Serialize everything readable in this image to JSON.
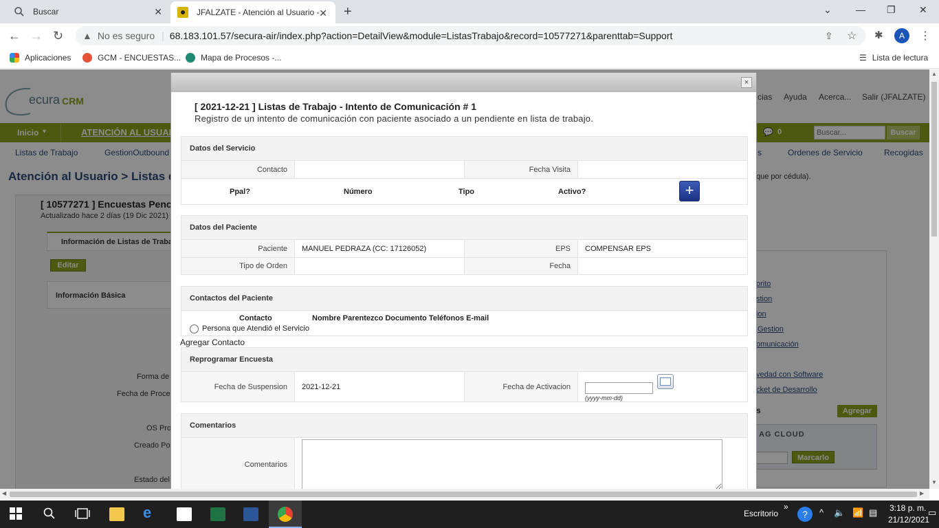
{
  "browser": {
    "tabs": [
      {
        "title": "Buscar",
        "icon": "search-icon"
      },
      {
        "title": "JFALZATE - Atención al Usuario -",
        "icon": "app-favicon"
      }
    ],
    "security_label": "No es seguro",
    "url": "68.183.101.57/secura-air/index.php?action=DetailView&module=ListasTrabajo&record=10577271&parenttab=Support",
    "profile_initial": "A",
    "bookmarks": [
      "Aplicaciones",
      "GCM - ENCUESTAS...",
      "Mapa de Procesos -..."
    ],
    "reading_list": "Lista de lectura"
  },
  "app": {
    "logo_text": "ecura",
    "logo_suffix": "CRM",
    "top_links": [
      "cias",
      "Ayuda",
      "Acerca...",
      "Salir (JFALZATE)"
    ],
    "menu": {
      "inicio": "Inicio",
      "section": "ATENCIÓN AL USUAR",
      "notif_count": "0",
      "search_placeholder": "Buscar...",
      "search_button": "Buscar"
    },
    "subnav": [
      "Listas de Trabajo",
      "GestionOutbound",
      "s",
      "Ordenes de Servicio",
      "Recogidas"
    ],
    "breadcrumb": "Atención al Usuario > Listas de",
    "right_note": "que por cédula).",
    "record_title": "[ 10577271 ] Encuestas Penc",
    "record_updated": "Actualizado hace 2 días (19 Dic 2021)",
    "record_tab": "Información de Listas de Traba",
    "edit_button": "Editar",
    "basic_info": "Información Básica",
    "field_labels": [
      "Forma de",
      "Fecha de Proce",
      "OS Pro",
      "Creado Po",
      "Estado del"
    ],
    "side_links": [
      "orito",
      "stion",
      "ion",
      "Gestion",
      "omunicación",
      "vedad con Software",
      "cket de Desarrollo"
    ],
    "side_box_title": "s",
    "side_add_button": "Agregar",
    "tag_cloud": "AG CLOUD",
    "mark_button": "Marcarlo"
  },
  "modal": {
    "close": "×",
    "title": "[ 2021-12-21 ] Listas de Trabajo - Intento de Comunicación # 1",
    "subtitle": "Registro de un intento de comunicación con paciente asociado a un pendiente en lista de trabajo.",
    "servicio": {
      "header": "Datos del Servicio",
      "contacto_label": "Contacto",
      "contacto_value": "",
      "fecha_visita_label": "Fecha Visita",
      "fecha_visita_value": "",
      "cols": [
        "Ppal?",
        "Número",
        "Tipo",
        "Activo?"
      ],
      "add_icon": "plus-icon"
    },
    "paciente": {
      "header": "Datos del Paciente",
      "paciente_label": "Paciente",
      "paciente_value": "MANUEL PEDRAZA (CC: 17126052)",
      "eps_label": "EPS",
      "eps_value": "COMPENSAR EPS",
      "tipo_orden_label": "Tipo de Orden",
      "tipo_orden_value": "",
      "fecha_label": "Fecha",
      "fecha_value": ""
    },
    "contactos": {
      "header": "Contactos del Paciente",
      "col_contacto": "Contacto",
      "cols": "Nombre Parentezco Documento Teléfonos E-mail",
      "radio_label": "Persona que Atendió el Servicio",
      "add_link": "Agregar Contacto"
    },
    "reprogramar": {
      "header": "Reprogramar Encuesta",
      "suspension_label": "Fecha de Suspension",
      "suspension_value": "2021-12-21",
      "activacion_label": "Fecha de Activacion",
      "activacion_value": "",
      "date_hint": "(yyyy-mm-dd)"
    },
    "comentarios": {
      "header": "Comentarios",
      "label": "Comentarios",
      "value": ""
    }
  },
  "taskbar": {
    "desktop_label": "Escritorio",
    "time": "3:18 p. m.",
    "date": "21/12/2021"
  },
  "colors": {
    "menu_green": "#8aa31b",
    "link_blue": "#2d4a7a",
    "plus_blue": "#2a46a0"
  }
}
